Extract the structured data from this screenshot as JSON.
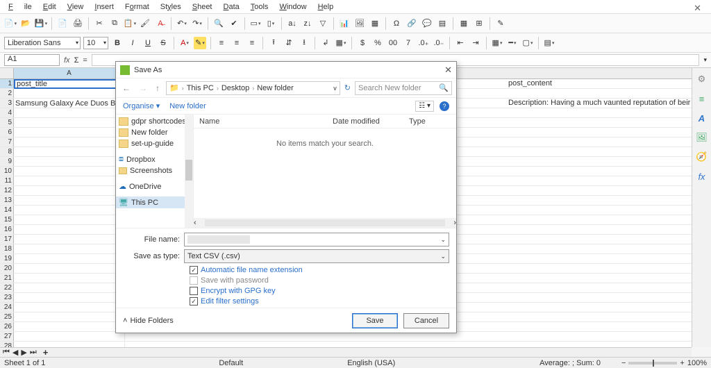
{
  "menu": {
    "file": "File",
    "edit": "Edit",
    "view": "View",
    "insert": "Insert",
    "format": "Format",
    "styles": "Styles",
    "sheet": "Sheet",
    "data": "Data",
    "tools": "Tools",
    "window": "Window",
    "help": "Help"
  },
  "format_bar": {
    "font": "Liberation Sans",
    "size": "10"
  },
  "cell_ref": "A1",
  "formula_value": "",
  "columns": {
    "A": "A"
  },
  "cells": {
    "A1": "post_title",
    "A3": "Samsung Galaxy Ace Duos By",
    "G_header": "post_content",
    "G3": "Description: Having a much vaunted reputation of beir"
  },
  "right_sidebar": [
    "≡",
    "A",
    "⬚",
    "🧭",
    "fx"
  ],
  "sheet_tab": "Sheet 1 of 1",
  "status": {
    "style": "Default",
    "lang": "English (USA)",
    "stats": "Average: ; Sum: 0",
    "zoom": "100%"
  },
  "dialog": {
    "title": "Save As",
    "breadcrumb": [
      "This PC",
      "Desktop",
      "New folder"
    ],
    "search_placeholder": "Search New folder",
    "organise": "Organise",
    "new_folder_btn": "New folder",
    "tree": [
      {
        "label": "gdpr shortcodes",
        "type": "folder"
      },
      {
        "label": "New folder",
        "type": "folder"
      },
      {
        "label": "set-up-guide",
        "type": "folder"
      },
      {
        "label": "Dropbox",
        "type": "dropbox"
      },
      {
        "label": "Screenshots",
        "type": "folder-small"
      },
      {
        "label": "OneDrive",
        "type": "onedrive"
      },
      {
        "label": "This PC",
        "type": "pc",
        "selected": true
      }
    ],
    "list_headers": {
      "name": "Name",
      "date": "Date modified",
      "type": "Type"
    },
    "empty_msg": "No items match your search.",
    "file_name_label": "File name:",
    "save_type_label": "Save as type:",
    "save_type_value": "Text CSV (.csv)",
    "chk_auto": "Automatic file name extension",
    "chk_pwd": "Save with password",
    "chk_gpg": "Encrypt with GPG key",
    "chk_filter": "Edit filter settings",
    "hide_folders": "Hide Folders",
    "save": "Save",
    "cancel": "Cancel"
  }
}
